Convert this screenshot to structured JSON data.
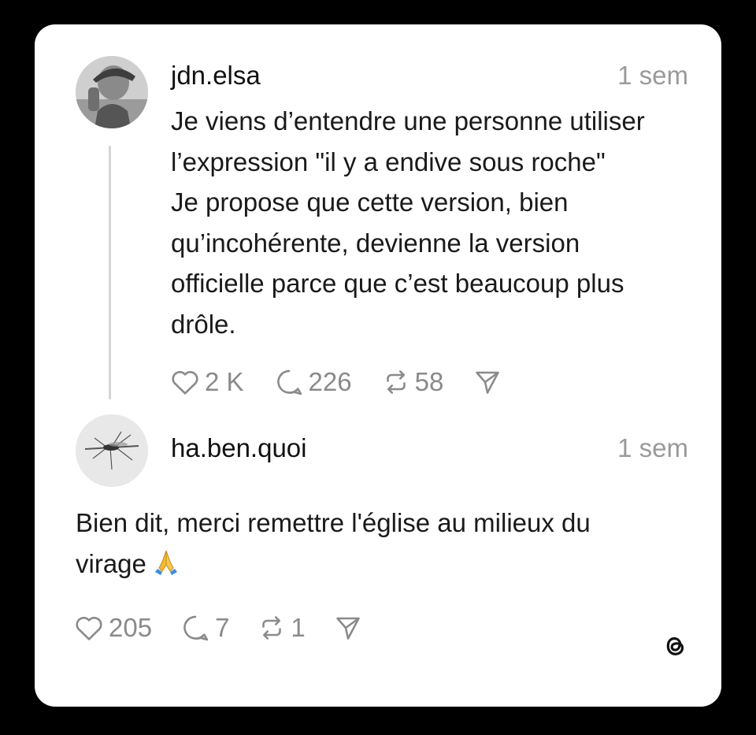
{
  "post": {
    "username": "jdn.elsa",
    "time": "1 sem",
    "text_lines": [
      "Je viens d’entendre une personne utiliser",
      "l’expression \"il y a endive sous roche\"",
      "Je propose que cette version, bien",
      "qu’incohérente, devienne la version",
      "officielle parce que c’est beaucoup plus",
      "drôle."
    ],
    "likes": "2 K",
    "replies": "226",
    "reposts": "58"
  },
  "reply": {
    "username": "ha.ben.quoi",
    "time": "1 sem",
    "text_lines": [
      "Bien dit, merci remettre l'église au milieux du",
      "virage"
    ],
    "emoji": "🙏",
    "likes": "205",
    "replies": "7",
    "reposts": "1"
  },
  "icons": {
    "like": "heart-icon",
    "reply": "comment-icon",
    "repost": "repost-icon",
    "share": "send-icon",
    "brand": "threads-logo-icon"
  },
  "colors": {
    "background": "#000000",
    "card": "#ffffff",
    "text": "#1a1a1a",
    "muted": "#8a8a8a"
  }
}
